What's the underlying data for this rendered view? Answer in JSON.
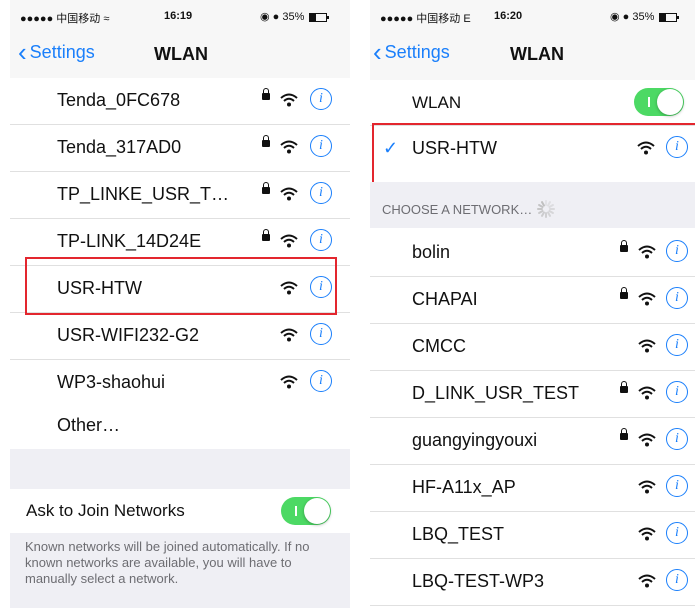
{
  "left": {
    "status": {
      "signal": "●●●●● 中国移动 ≈",
      "time": "16:19",
      "icons": "◉ ● 35%",
      "battery_fraction": 0.35
    },
    "nav": {
      "back": "Settings",
      "title": "WLAN"
    },
    "networks": [
      {
        "name": "Tenda_0FC678",
        "locked": true
      },
      {
        "name": "Tenda_317AD0",
        "locked": true
      },
      {
        "name": "TP_LINKE_USR_T…",
        "locked": true
      },
      {
        "name": "TP-LINK_14D24E",
        "locked": true
      },
      {
        "name": "USR-HTW",
        "locked": false
      },
      {
        "name": "USR-WIFI232-G2",
        "locked": false
      },
      {
        "name": "WP3-shaohui",
        "locked": false
      }
    ],
    "other": "Other…",
    "ask_to_join": {
      "label": "Ask to Join Networks",
      "on": true
    },
    "footer": "Known networks will be joined automatically. If no known networks are available, you will have to manually select a network."
  },
  "right": {
    "status": {
      "signal": "●●●●● 中国移动 E",
      "time": "16:20",
      "icons": "◉ ● 35%",
      "battery_fraction": 0.35
    },
    "nav": {
      "back": "Settings",
      "title": "WLAN"
    },
    "wlan_toggle": {
      "label": "WLAN",
      "on": true
    },
    "connected": {
      "name": "USR-HTW",
      "check": "✓"
    },
    "choose_header": "CHOOSE A NETWORK…",
    "networks": [
      {
        "name": "bolin",
        "locked": true
      },
      {
        "name": "CHAPAI",
        "locked": true
      },
      {
        "name": "CMCC",
        "locked": false
      },
      {
        "name": "D_LINK_USR_TEST",
        "locked": true
      },
      {
        "name": "guangyingyouxi",
        "locked": true
      },
      {
        "name": "HF-A11x_AP",
        "locked": false
      },
      {
        "name": "LBQ_TEST",
        "locked": false
      },
      {
        "name": "LBQ-TEST-WP3",
        "locked": false
      }
    ]
  },
  "colors": {
    "accent": "#1a7ffb",
    "toggle_on": "#4cd964",
    "highlight": "#e3262e"
  }
}
